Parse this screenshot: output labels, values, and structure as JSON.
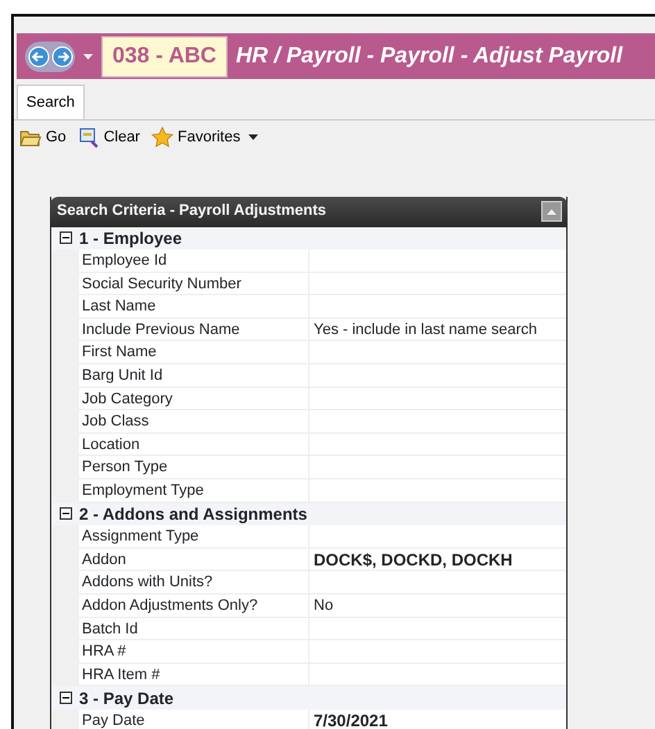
{
  "title_bar": {
    "code": "038 - ABC",
    "title": "HR / Payroll - Payroll - Adjust Payroll"
  },
  "tabs": [
    {
      "label": "Search",
      "selected": true
    }
  ],
  "toolbar": [
    {
      "label": "Go",
      "kind": "folder"
    },
    {
      "label": "Clear",
      "kind": "clear"
    },
    {
      "label": "Favorites",
      "kind": "star",
      "dropdown": true
    }
  ],
  "panel": {
    "title": "Search Criteria - Payroll Adjustments",
    "sections": [
      {
        "title": "1 - Employee",
        "expanded": true,
        "fields": [
          {
            "label": "Employee Id",
            "bold": false
          },
          {
            "label": "Social Security Number",
            "bold": false
          },
          {
            "label": "Last Name",
            "bold": false
          },
          {
            "label": "Include Previous Name",
            "value": "Yes - include in last name search",
            "bold": false
          },
          {
            "label": "First Name",
            "bold": false
          },
          {
            "label": "Barg Unit Id",
            "bold": false
          },
          {
            "label": "Job Category",
            "bold": false
          },
          {
            "label": "Job Class",
            "bold": false
          },
          {
            "label": "Location",
            "bold": false
          },
          {
            "label": "Person Type",
            "bold": false
          },
          {
            "label": "Employment Type",
            "bold": false
          }
        ]
      },
      {
        "title": "2 - Addons and Assignments",
        "expanded": true,
        "fields": [
          {
            "label": "Assignment Type",
            "bold": false
          },
          {
            "label": "Addon",
            "value": "DOCK$, DOCKD, DOCKH",
            "bold": true
          },
          {
            "label": "Addons with Units?",
            "bold": false
          },
          {
            "label": "Addon Adjustments Only?",
            "value": "No",
            "bold": false
          },
          {
            "label": "Batch Id",
            "bold": false
          },
          {
            "label": "HRA #",
            "bold": false
          },
          {
            "label": "HRA Item #",
            "bold": false
          }
        ]
      },
      {
        "title": "3 - Pay Date",
        "expanded": true,
        "fields": [
          {
            "label": "Pay Date",
            "value": "7/30/2021",
            "bold": true
          }
        ]
      }
    ]
  }
}
